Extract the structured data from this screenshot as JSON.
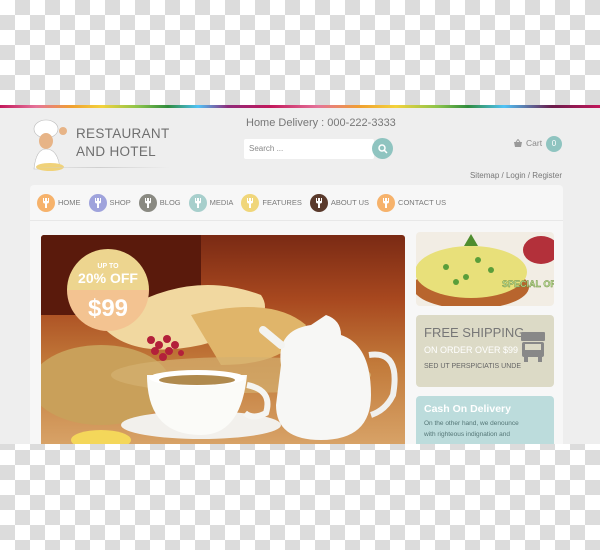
{
  "brand": {
    "line1": "RESTAURANT",
    "line2": "AND HOTEL"
  },
  "header": {
    "delivery_label": "Home Delivery : 000-222-3333",
    "search_placeholder": "Search ...",
    "cart_label": "Cart",
    "cart_count": "0",
    "links": "Sitemap / Login / Register"
  },
  "nav": {
    "items": [
      {
        "label": "HOME",
        "color": "#f6b26b"
      },
      {
        "label": "SHOP",
        "color": "#9fa3dc"
      },
      {
        "label": "BLOG",
        "color": "#8a8a82"
      },
      {
        "label": "MEDIA",
        "color": "#a7cfcc"
      },
      {
        "label": "FEATURES",
        "color": "#f0d67a"
      },
      {
        "label": "ABOUT US",
        "color": "#5a3a2c"
      },
      {
        "label": "CONTACT US",
        "color": "#f6b26b"
      }
    ]
  },
  "slider": {
    "badge_top": "UP TO",
    "badge_discount": "20% OFF",
    "badge_price": "$99"
  },
  "special": {
    "label": "SPECIAL OFFER"
  },
  "shipping": {
    "title": "FREE SHIPPING",
    "subtitle": "ON ORDER OVER $99",
    "desc": "SED UT PERSPICIATIS UNDE"
  },
  "cod": {
    "title": "Cash On Delivery",
    "text_line1": "On the other hand, we denounce",
    "text_line2": "with righteous indignation and"
  }
}
